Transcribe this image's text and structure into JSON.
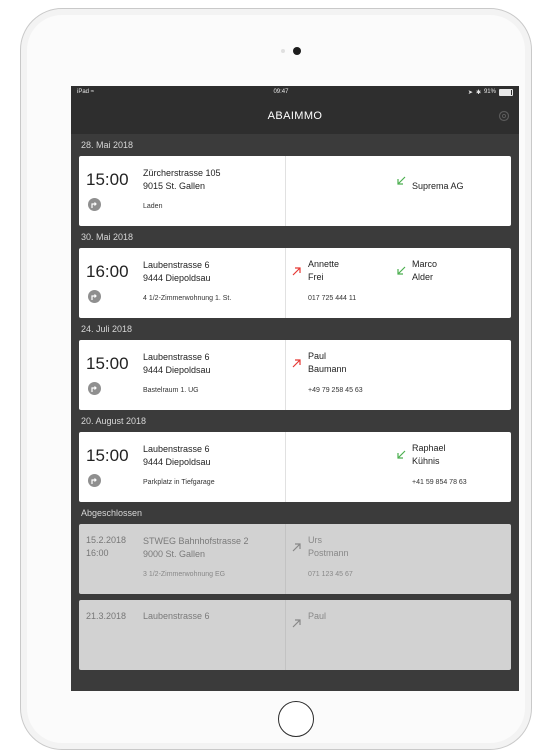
{
  "status_bar": {
    "device": "iPad",
    "time": "09:47",
    "battery": "91%"
  },
  "app": {
    "title": "ABAIMMO"
  },
  "colors": {
    "incoming": "#4caf50",
    "outgoing": "#e53935",
    "screen": "#3b3b3b",
    "card": "#ffffff",
    "card_done": "#d2d2d2"
  },
  "sections": [
    {
      "header": "28. Mai 2018",
      "time": "15:00",
      "street": "Zürcherstrasse 105",
      "city": "9015 St. Gallen",
      "desc": "Laden",
      "p2_name": "Suprema AG"
    },
    {
      "header": "30. Mai 2018",
      "time": "16:00",
      "street": "Laubenstrasse 6",
      "city": "9444 Diepoldsau",
      "desc": "4 1/2-Zimmerwohnung 1. St.",
      "p1_first": "Annette",
      "p1_last": "Frei",
      "p1_phone": "017 725 444 11",
      "p2_first": "Marco",
      "p2_last": "Alder"
    },
    {
      "header": "24. Juli 2018",
      "time": "15:00",
      "street": "Laubenstrasse 6",
      "city": "9444 Diepoldsau",
      "desc": "Bastelraum 1. UG",
      "p1_first": "Paul",
      "p1_last": "Baumann",
      "p1_phone": "+49 79 258 45 63"
    },
    {
      "header": "20. August 2018",
      "time": "15:00",
      "street": "Laubenstrasse 6",
      "city": "9444 Diepoldsau",
      "desc": "Parkplatz in Tiefgarage",
      "p2_first": "Raphael",
      "p2_last": "Kühnis",
      "p2_phone": "+41 59 854 78 63"
    }
  ],
  "closed": {
    "header": "Abgeschlossen",
    "items": [
      {
        "date": "15.2.2018",
        "time": "16:00",
        "street": "STWEG Bahnhofstrasse 2",
        "city": "9000 St. Gallen",
        "desc": "3 1/2-Zimmerwohnung EG",
        "p1_first": "Urs",
        "p1_last": "Postmann",
        "p1_phone": "071 123 45 67"
      },
      {
        "date": "21.3.2018",
        "street": "Laubenstrasse 6",
        "p1_first": "Paul"
      }
    ]
  }
}
